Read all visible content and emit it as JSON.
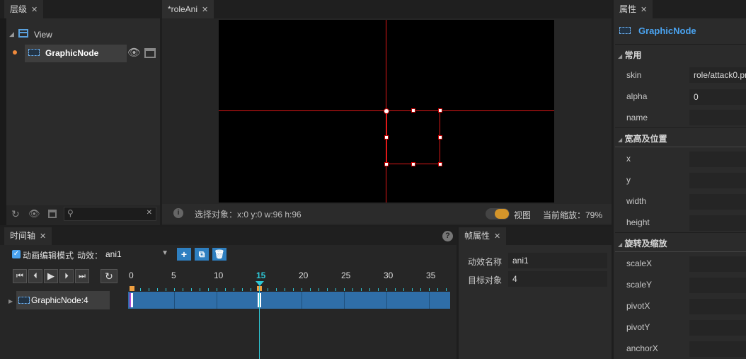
{
  "hierarchy": {
    "tab_label": "层级",
    "root_label": "View",
    "node_label": "GraphicNode"
  },
  "scene": {
    "tab_label": "*roleAni",
    "status_text": "选择对象：x:0 y:0  w:96 h:96",
    "view_label": "视图",
    "zoom_text": "当前缩放：79%"
  },
  "timeline": {
    "tab_label": "时间轴",
    "edit_mode_label": "动画编辑模式",
    "effect_label": "动效：",
    "effect_value": "ani1",
    "ruler_ticks": [
      "0",
      "5",
      "10",
      "15",
      "20",
      "25",
      "30",
      "35"
    ],
    "current_frame": "15",
    "track_label": "GraphicNode:4"
  },
  "frame_props": {
    "tab_label": "帧属性",
    "effect_name_label": "动效名称",
    "effect_name_value": "ani1",
    "target_label": "目标对象",
    "target_value": "4"
  },
  "properties": {
    "tab_label": "属性",
    "node_title": "GraphicNode",
    "section_common": "常用",
    "skin_label": "skin",
    "skin_value": "role/attack0.pn",
    "alpha_label": "alpha",
    "alpha_value": "0",
    "name_label": "name",
    "section_size": "宽高及位置",
    "x_label": "x",
    "y_label": "y",
    "width_label": "width",
    "height_label": "height",
    "section_rotate": "旋转及缩放",
    "scaleX_label": "scaleX",
    "scaleY_label": "scaleY",
    "pivotX_label": "pivotX",
    "pivotY_label": "pivotY",
    "anchorX_label": "anchorX"
  },
  "colors": {
    "accent_blue": "#4aa3f0",
    "track_blue": "#2f6ea8",
    "playhead_cyan": "#2ec7d6",
    "keyframe_orange": "#f0a040",
    "guide_red": "#e01818",
    "toggle_orange": "#d4952a"
  }
}
